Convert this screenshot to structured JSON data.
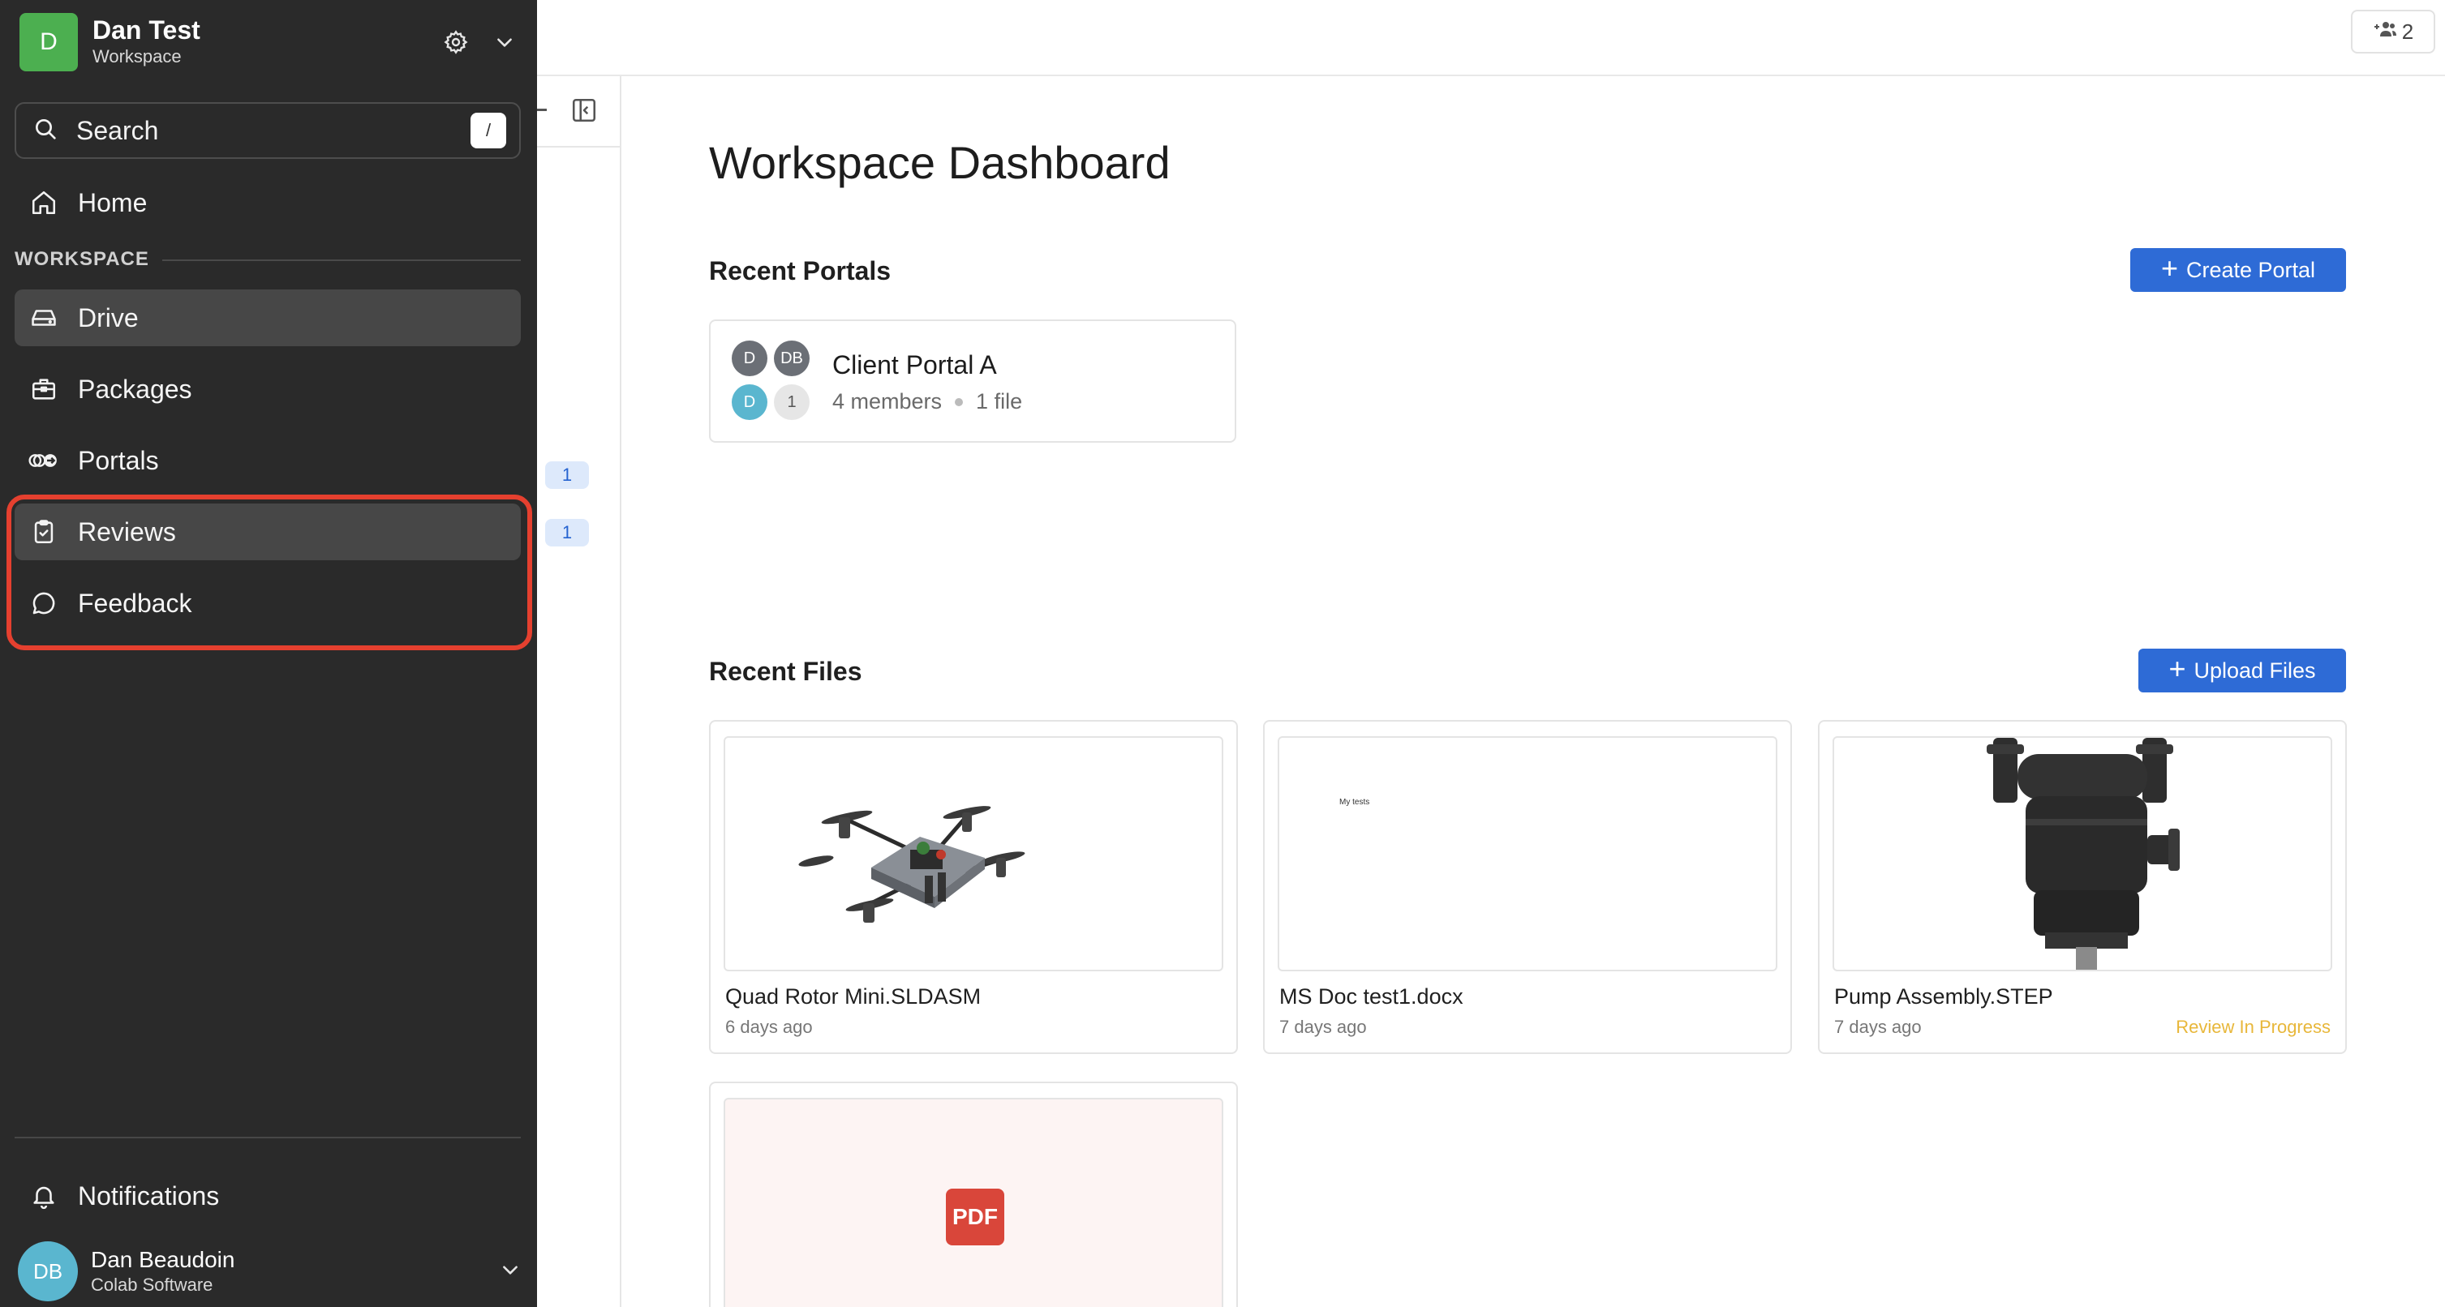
{
  "workspace": {
    "initial": "D",
    "name": "Dan Test",
    "subtitle": "Workspace"
  },
  "search": {
    "label": "Search",
    "shortcut": "/"
  },
  "nav": {
    "home": "Home",
    "section_label": "WORKSPACE",
    "items": [
      {
        "label": "Drive",
        "icon": "drive-icon",
        "active": true
      },
      {
        "label": "Packages",
        "icon": "package-icon",
        "active": false
      },
      {
        "label": "Portals",
        "icon": "portal-icon",
        "active": false
      },
      {
        "label": "Reviews",
        "icon": "clipboard-check-icon",
        "active": true
      },
      {
        "label": "Feedback",
        "icon": "chat-bubble-icon",
        "active": false
      }
    ],
    "notifications": "Notifications"
  },
  "user": {
    "initials": "DB",
    "name": "Dan Beaudoin",
    "org": "Colab Software"
  },
  "side_panel": {
    "badges": [
      "1",
      "1"
    ]
  },
  "topbar": {
    "member_count": "2"
  },
  "main": {
    "title": "Workspace Dashboard",
    "recent_portals": {
      "title": "Recent Portals",
      "create_button": "Create Portal",
      "portals": [
        {
          "name": "Client Portal A",
          "members": "4 members",
          "files": "1 file",
          "avatars": [
            {
              "text": "D",
              "color": "#6b6f76"
            },
            {
              "text": "DB",
              "color": "#6b6f76"
            },
            {
              "text": "D",
              "color": "#5ab6cf"
            },
            {
              "text": "1",
              "color": "#e6e6e6"
            }
          ]
        }
      ]
    },
    "recent_files": {
      "title": "Recent Files",
      "upload_button": "Upload Files",
      "files": [
        {
          "name": "Quad Rotor Mini.SLDASM",
          "age": "6 days ago",
          "status": ""
        },
        {
          "name": "MS Doc test1.docx",
          "age": "7 days ago",
          "status": "",
          "preview_text": "My tests"
        },
        {
          "name": "Pump Assembly.STEP",
          "age": "7 days ago",
          "status": "Review In Progress"
        },
        {
          "name": "",
          "age": "",
          "status": "",
          "preview_label": "PDF"
        }
      ]
    }
  },
  "colors": {
    "sidebar_bg": "#2a2a2a",
    "accent": "#2e6bd6",
    "highlight": "#e5402f",
    "status_warning": "#e8b73a"
  }
}
